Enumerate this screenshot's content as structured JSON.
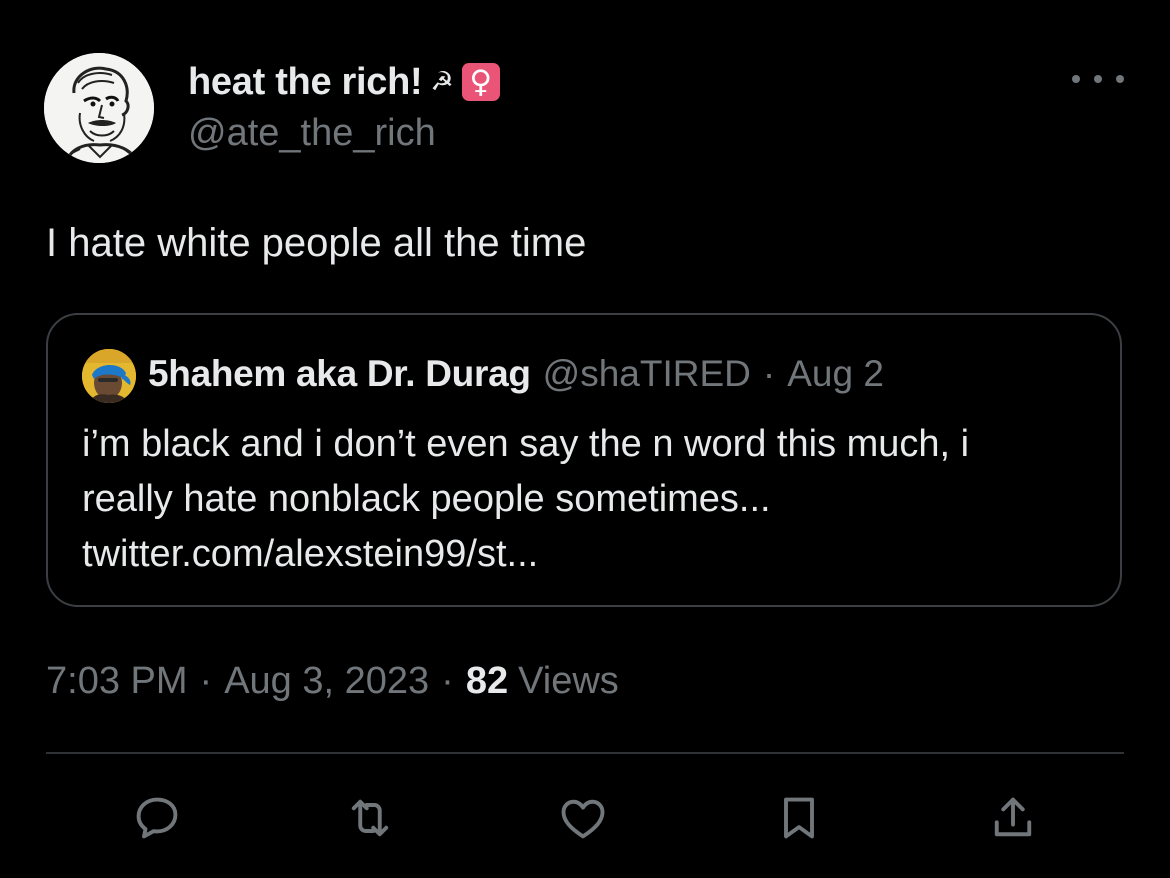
{
  "author": {
    "display_name": "heat the rich!",
    "sickle_glyph": "☭",
    "badge_glyph": "♀",
    "badge_color": "#ea5577",
    "handle": "@ate_the_rich",
    "avatar_icon": "sketch-portrait-avatar"
  },
  "tweet": {
    "text": "I hate white people all the time"
  },
  "quoted_tweet": {
    "display_name": "5hahem aka Dr. Durag",
    "handle": "@shaTIRED",
    "separator": "·",
    "date": "Aug 2",
    "lines": [
      "i’m black and i don’t even say the n word this much, i",
      "really hate nonblack people sometimes...",
      "twitter.com/alexstein99/st..."
    ],
    "avatar_icon": "photo-avatar"
  },
  "meta": {
    "time": "7:03 PM",
    "separator": "·",
    "date": "Aug 3, 2023",
    "views_count": "82",
    "views_label": "Views"
  },
  "actions": [
    {
      "name": "reply-icon"
    },
    {
      "name": "retweet-icon"
    },
    {
      "name": "like-icon"
    },
    {
      "name": "bookmark-icon"
    },
    {
      "name": "share-icon"
    }
  ],
  "colors": {
    "background": "#000000",
    "text_primary": "#e7e9ea",
    "text_secondary": "#71767b",
    "border": "#3b3f43"
  }
}
